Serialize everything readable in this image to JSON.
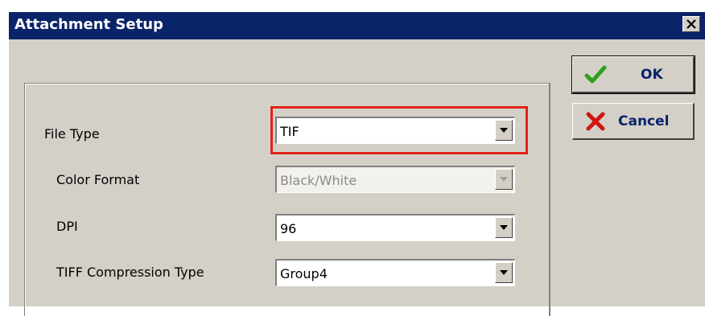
{
  "window": {
    "title": "Attachment Setup",
    "close_icon": "close-icon"
  },
  "fields": [
    {
      "label": "File Type",
      "value": "TIF",
      "enabled": true,
      "highlighted": true
    },
    {
      "label": "Color Format",
      "value": "Black/White",
      "enabled": false,
      "highlighted": false
    },
    {
      "label": "DPI",
      "value": "96",
      "enabled": true,
      "highlighted": false
    },
    {
      "label": "TIFF Compression Type",
      "value": "Group4",
      "enabled": true,
      "highlighted": false
    }
  ],
  "buttons": {
    "ok": {
      "label": "OK",
      "icon": "checkmark-icon",
      "color": "#2e9e1e"
    },
    "cancel": {
      "label": "Cancel",
      "icon": "x-icon",
      "color": "#d0150f"
    }
  },
  "colors": {
    "titlebar": "#0a246a",
    "highlight": "#e2231a",
    "dialog": "#d4d0c8"
  }
}
